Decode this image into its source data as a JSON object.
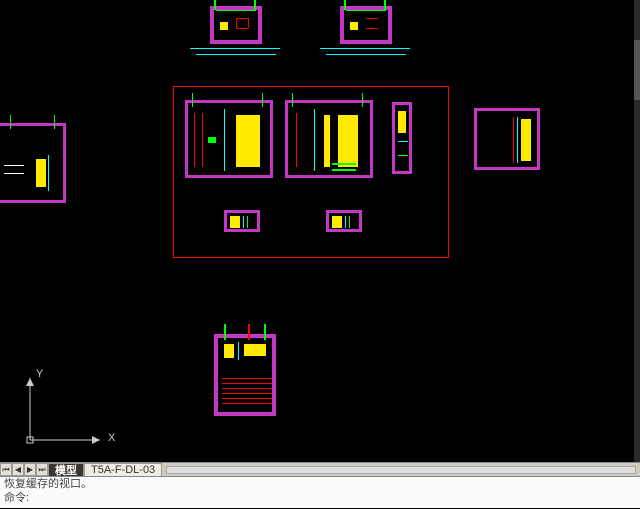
{
  "tabs": {
    "nav_first": "⏮",
    "nav_prev": "◀",
    "nav_next": "▶",
    "nav_last": "⏭",
    "active_label": "模型",
    "layout1_label": "T5A-F-DL-03"
  },
  "command": {
    "history_line": "恢复缓存的视口。",
    "prompt": "命令:",
    "input_value": ""
  },
  "ucs": {
    "x_label": "X",
    "y_label": "Y"
  }
}
